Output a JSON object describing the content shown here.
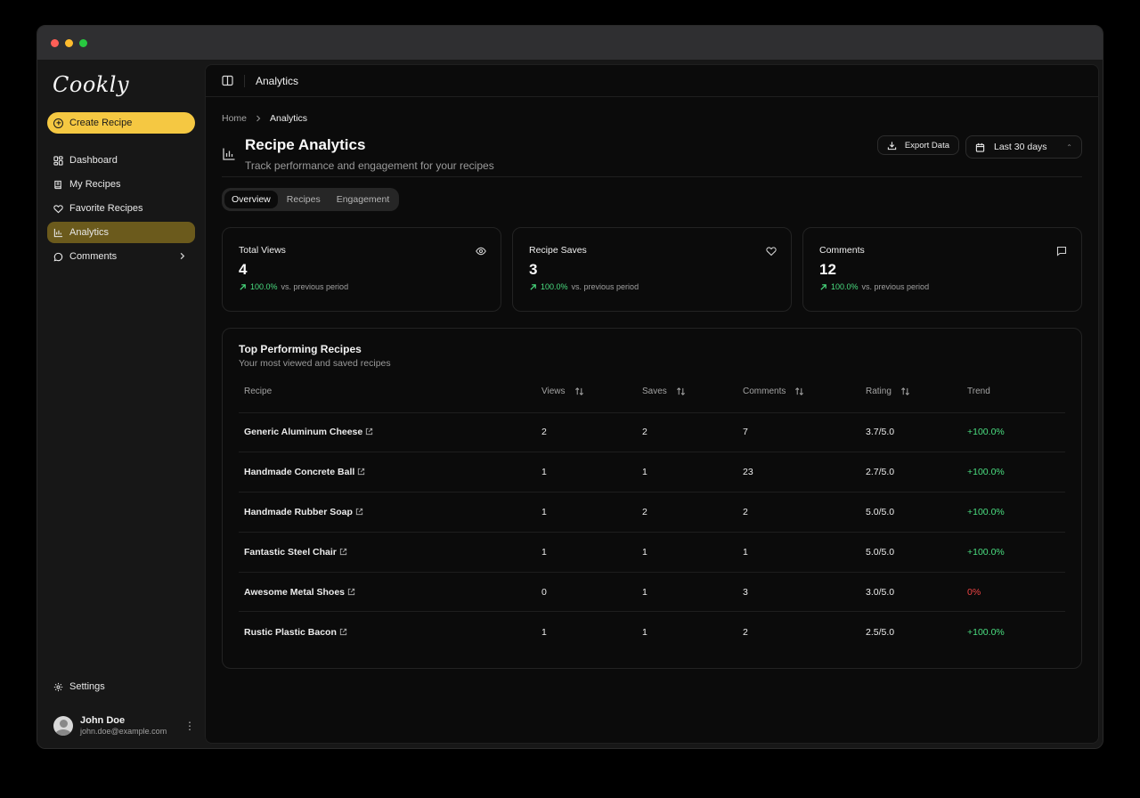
{
  "app": {
    "logo": "Cookly",
    "create_label": "Create Recipe"
  },
  "nav": [
    {
      "label": "Dashboard",
      "icon": "dashboard-icon"
    },
    {
      "label": "My Recipes",
      "icon": "book-icon"
    },
    {
      "label": "Favorite Recipes",
      "icon": "heart-icon"
    },
    {
      "label": "Analytics",
      "icon": "bar-chart-icon",
      "active": true
    },
    {
      "label": "Comments",
      "icon": "message-icon",
      "has_submenu": true
    }
  ],
  "settings_label": "Settings",
  "user": {
    "name": "John Doe",
    "email": "john.doe@example.com"
  },
  "topbar": {
    "title": "Analytics"
  },
  "breadcrumb": {
    "home": "Home",
    "current": "Analytics"
  },
  "header": {
    "title": "Recipe Analytics",
    "subtitle": "Track performance and engagement for your recipes",
    "export_label": "Export Data",
    "date_range": "Last 30 days"
  },
  "tabs": [
    "Overview",
    "Recipes",
    "Engagement"
  ],
  "cards": [
    {
      "title": "Total Views",
      "value": "4",
      "pct": "100.0%",
      "suffix": "vs. previous period",
      "icon": "eye-icon"
    },
    {
      "title": "Recipe Saves",
      "value": "3",
      "pct": "100.0%",
      "suffix": "vs. previous period",
      "icon": "heart-icon"
    },
    {
      "title": "Comments",
      "value": "12",
      "pct": "100.0%",
      "suffix": "vs. previous period",
      "icon": "message-icon"
    }
  ],
  "top_recipes": {
    "title": "Top Performing Recipes",
    "subtitle": "Your most viewed and saved recipes",
    "columns": [
      "Recipe",
      "Views",
      "Saves",
      "Comments",
      "Rating",
      "Trend"
    ],
    "rows": [
      {
        "name": "Generic Aluminum Cheese",
        "views": "2",
        "saves": "2",
        "comments": "7",
        "rating": "3.7/5.0",
        "trend": "+100.0%"
      },
      {
        "name": "Handmade Concrete Ball",
        "views": "1",
        "saves": "1",
        "comments": "23",
        "rating": "2.7/5.0",
        "trend": "+100.0%"
      },
      {
        "name": "Handmade Rubber Soap",
        "views": "1",
        "saves": "2",
        "comments": "2",
        "rating": "5.0/5.0",
        "trend": "+100.0%"
      },
      {
        "name": "Fantastic Steel Chair",
        "views": "1",
        "saves": "1",
        "comments": "1",
        "rating": "5.0/5.0",
        "trend": "+100.0%"
      },
      {
        "name": "Awesome Metal Shoes",
        "views": "0",
        "saves": "1",
        "comments": "3",
        "rating": "3.0/5.0",
        "trend": "0%"
      },
      {
        "name": "Rustic Plastic Bacon",
        "views": "1",
        "saves": "1",
        "comments": "2",
        "rating": "2.5/5.0",
        "trend": "+100.0%"
      }
    ]
  },
  "colors": {
    "accent": "#f5c842",
    "active_nav": "#6b5a1c",
    "positive": "#4ade80",
    "negative": "#ef4444"
  }
}
